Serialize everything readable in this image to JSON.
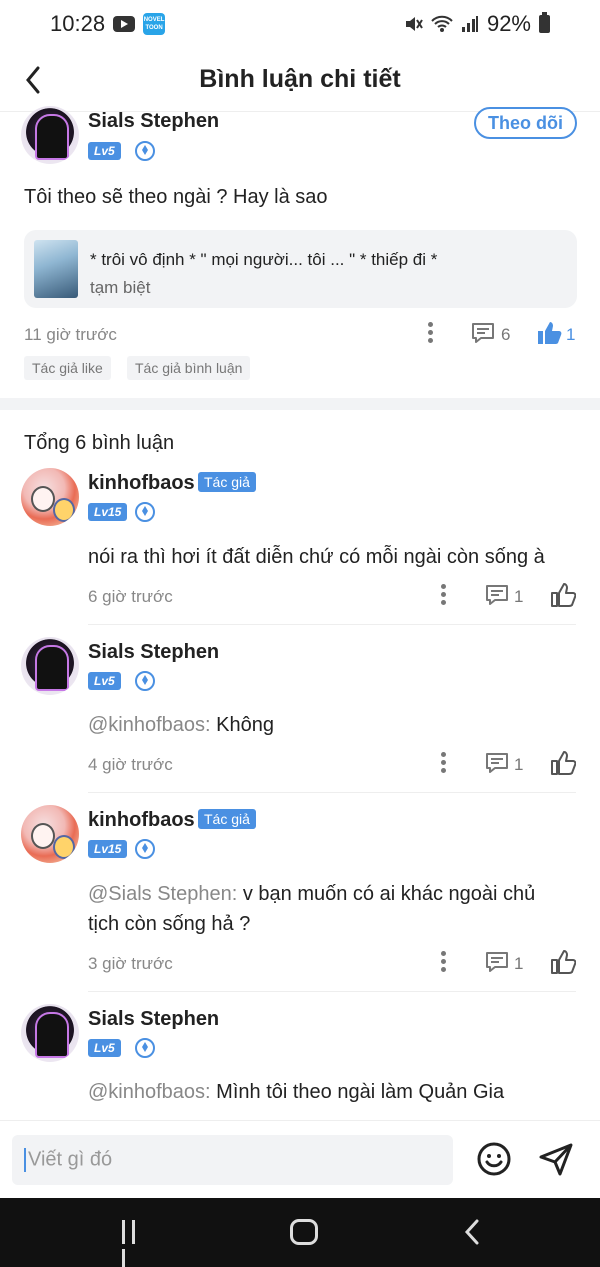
{
  "status_bar": {
    "time": "10:28",
    "battery": "92%"
  },
  "header": {
    "title": "Bình luận chi tiết"
  },
  "post": {
    "author": "Sials Stephen",
    "level": "Lv5",
    "follow_label": "Theo dõi",
    "text": "Tôi theo sẽ theo ngài ? Hay là sao",
    "quote_line1": "* trôi vô định * \" mọi người... tôi ... \" * thiếp đi *",
    "quote_line2": "tạm biệt",
    "time": "11 giờ trước",
    "comment_count": "6",
    "like_count": "1",
    "tags": [
      "Tác giả like",
      "Tác giả bình luận"
    ]
  },
  "total_label": "Tổng 6 bình luận",
  "comments": [
    {
      "name": "kinhofbaos",
      "author_badge": "Tác giả",
      "level": "Lv15",
      "mention": "",
      "text": "nói ra thì hơi ít đất diễn chứ có mỗi ngài còn sống à",
      "time": "6 giờ trước",
      "replies": "1"
    },
    {
      "name": "Sials Stephen",
      "author_badge": "",
      "level": "Lv5",
      "mention": "@kinhofbaos:",
      "text": "Không",
      "time": "4 giờ trước",
      "replies": "1"
    },
    {
      "name": "kinhofbaos",
      "author_badge": "Tác giả",
      "level": "Lv15",
      "mention": "@Sials Stephen:",
      "text": "v bạn muốn có ai khác ngoài chủ tịch còn sống hả ?",
      "time": "3 giờ trước",
      "replies": "1"
    },
    {
      "name": "Sials Stephen",
      "author_badge": "",
      "level": "Lv5",
      "mention": "@kinhofbaos:",
      "text": "Mình tôi theo ngài làm Quản Gia",
      "time": "",
      "replies": ""
    }
  ],
  "input": {
    "placeholder": "Viết gì đó"
  },
  "colors": {
    "accent": "#4a90e2",
    "tag_bg": "#f2f3f5"
  },
  "icons": [
    "back-icon",
    "youtube-icon",
    "novel-toon-icon",
    "mute-icon",
    "wifi-icon",
    "signal-icon",
    "battery-icon",
    "more-icon",
    "comment-icon",
    "like-icon",
    "emoji-icon",
    "send-icon",
    "gem-icon"
  ]
}
